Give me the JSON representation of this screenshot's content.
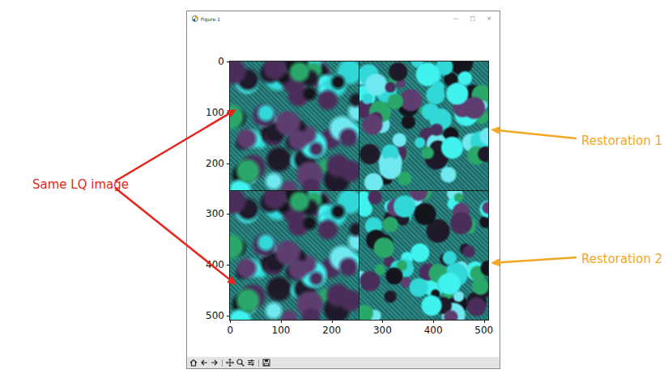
{
  "window": {
    "title": "Figure 1",
    "controls": [
      "—",
      "□",
      "×"
    ]
  },
  "figure": {
    "y_ticks": [
      "0",
      "100",
      "200",
      "300",
      "400",
      "500"
    ],
    "x_ticks": [
      "0",
      "100",
      "200",
      "300",
      "400",
      "500"
    ]
  },
  "annotations": [
    {
      "text": "Same LQ image",
      "color": "#e8231a"
    },
    {
      "text": "Restoration 1",
      "color": "#f5a623"
    },
    {
      "text": "Restoration 2",
      "color": "#f5a623"
    }
  ]
}
